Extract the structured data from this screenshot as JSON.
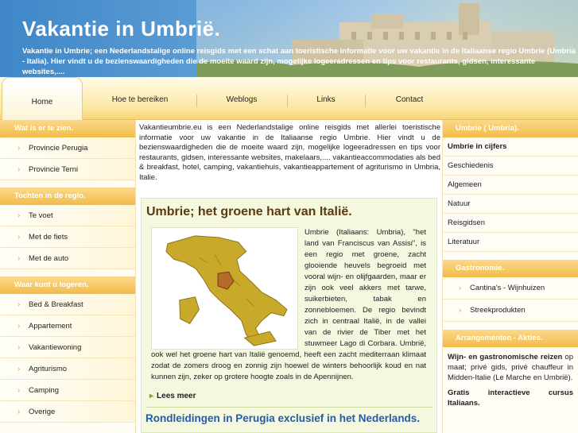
{
  "header": {
    "title": "Vakantie in Umbrië.",
    "tagline": "Vakantie in Umbrie; een Nederlandstalige online reisgids met een schat aan toeristische informatie voor uw vakantie in de Italiaanse regio Umbrie (Umbria - Italia). Hier vindt u de bezienswaardigheden die de moeite waard zijn, mogelijke logeeradressen en tips voor restaurants, gidsen, interessante websites,...."
  },
  "nav": {
    "items": [
      {
        "label": "Home"
      },
      {
        "label": "Hoe te bereiken"
      },
      {
        "label": "Weblogs"
      },
      {
        "label": "Links"
      },
      {
        "label": "Contact"
      }
    ]
  },
  "left": {
    "sections": [
      {
        "title": "Wat is er te zien.",
        "items": [
          "Provincie Perugia",
          "Provincie Terni"
        ]
      },
      {
        "title": "Tochten in de regio.",
        "items": [
          "Te voet",
          "Met de fiets",
          "Met de auto"
        ]
      },
      {
        "title": "Waar kunt u logeren.",
        "items": [
          "Bed & Breakfast",
          "Appartement",
          "Vakantiewoning",
          "Agriturismo",
          "Camping",
          "Overige"
        ]
      }
    ]
  },
  "main": {
    "intro": "Vakantieumbrie.eu is een Nederlandstalige online reisgids met allerlei toeristische informatie voor uw vakantie in de Italiaanse regio Umbrie. Hier vindt u de bezienswaardigheden die de moeite waard zijn, mogelijke logeeradressen en tips voor restaurants, gidsen, interessante websites, makelaars,.... vakantieaccommodaties als bed & breakfast, hotel, camping, vakantiehuis, vakantieappartement of agriturismo in Umbria, Italie.",
    "heading": "Umbrie; het groene hart van Italië.",
    "description": "Umbrie (Italiaans: Umbria), \"het land van Franciscus van Assisi\", is een regio met groene, zacht glooiende heuvels begroeid met vooral wijn- en olijfgaarden, maar er zijn ook veel akkers met tarwe, suikerbieten, tabak en zonnebloemen. De regio bevindt zich in centraal Italië, in de vallei van de rivier de Tiber met het stuwmeer Lago di Corbara. Umbrië, ook wel het groene hart van Italië genoemd, heeft een zacht mediterraan klimaat zodat de zomers droog en zonnig zijn hoewel de winters behoorlijk koud en nat kunnen zijn, zeker op grotere hoogte zoals in de Apennijnen.",
    "read_more": "Lees meer",
    "perugia_title": "Rondleidingen in Perugia exclusief in het Nederlands."
  },
  "right": {
    "section1_title": "Umbrie ( Umbria).",
    "items": [
      "Umbrie in cijfers",
      "Geschiedenis",
      "Algemeen",
      "Natuur",
      "Reisgidsen",
      "Literatuur"
    ],
    "section2_title": "Gastronomie.",
    "gastro_items": [
      "Cantina's - Wijnhuizen",
      "Streekprodukten"
    ],
    "section3_title": "Arrangementen - Akties.",
    "arr_bold": "Wijn- en gastronomische reizen",
    "arr_text": " op maat; privé gids, privé chauffeur in Midden-Italie (Le Marche en Umbrië).",
    "arr2": "Gratis interactieve cursus Italiaans."
  },
  "colors": {
    "header_blue": "#3f87c8",
    "sidebar_header": "#f2bb4a",
    "title_brown": "#5b3a10",
    "link_blue": "#2a5aa0",
    "map_highlight": "#b56b2a",
    "map_italy": "#c9a92a"
  }
}
